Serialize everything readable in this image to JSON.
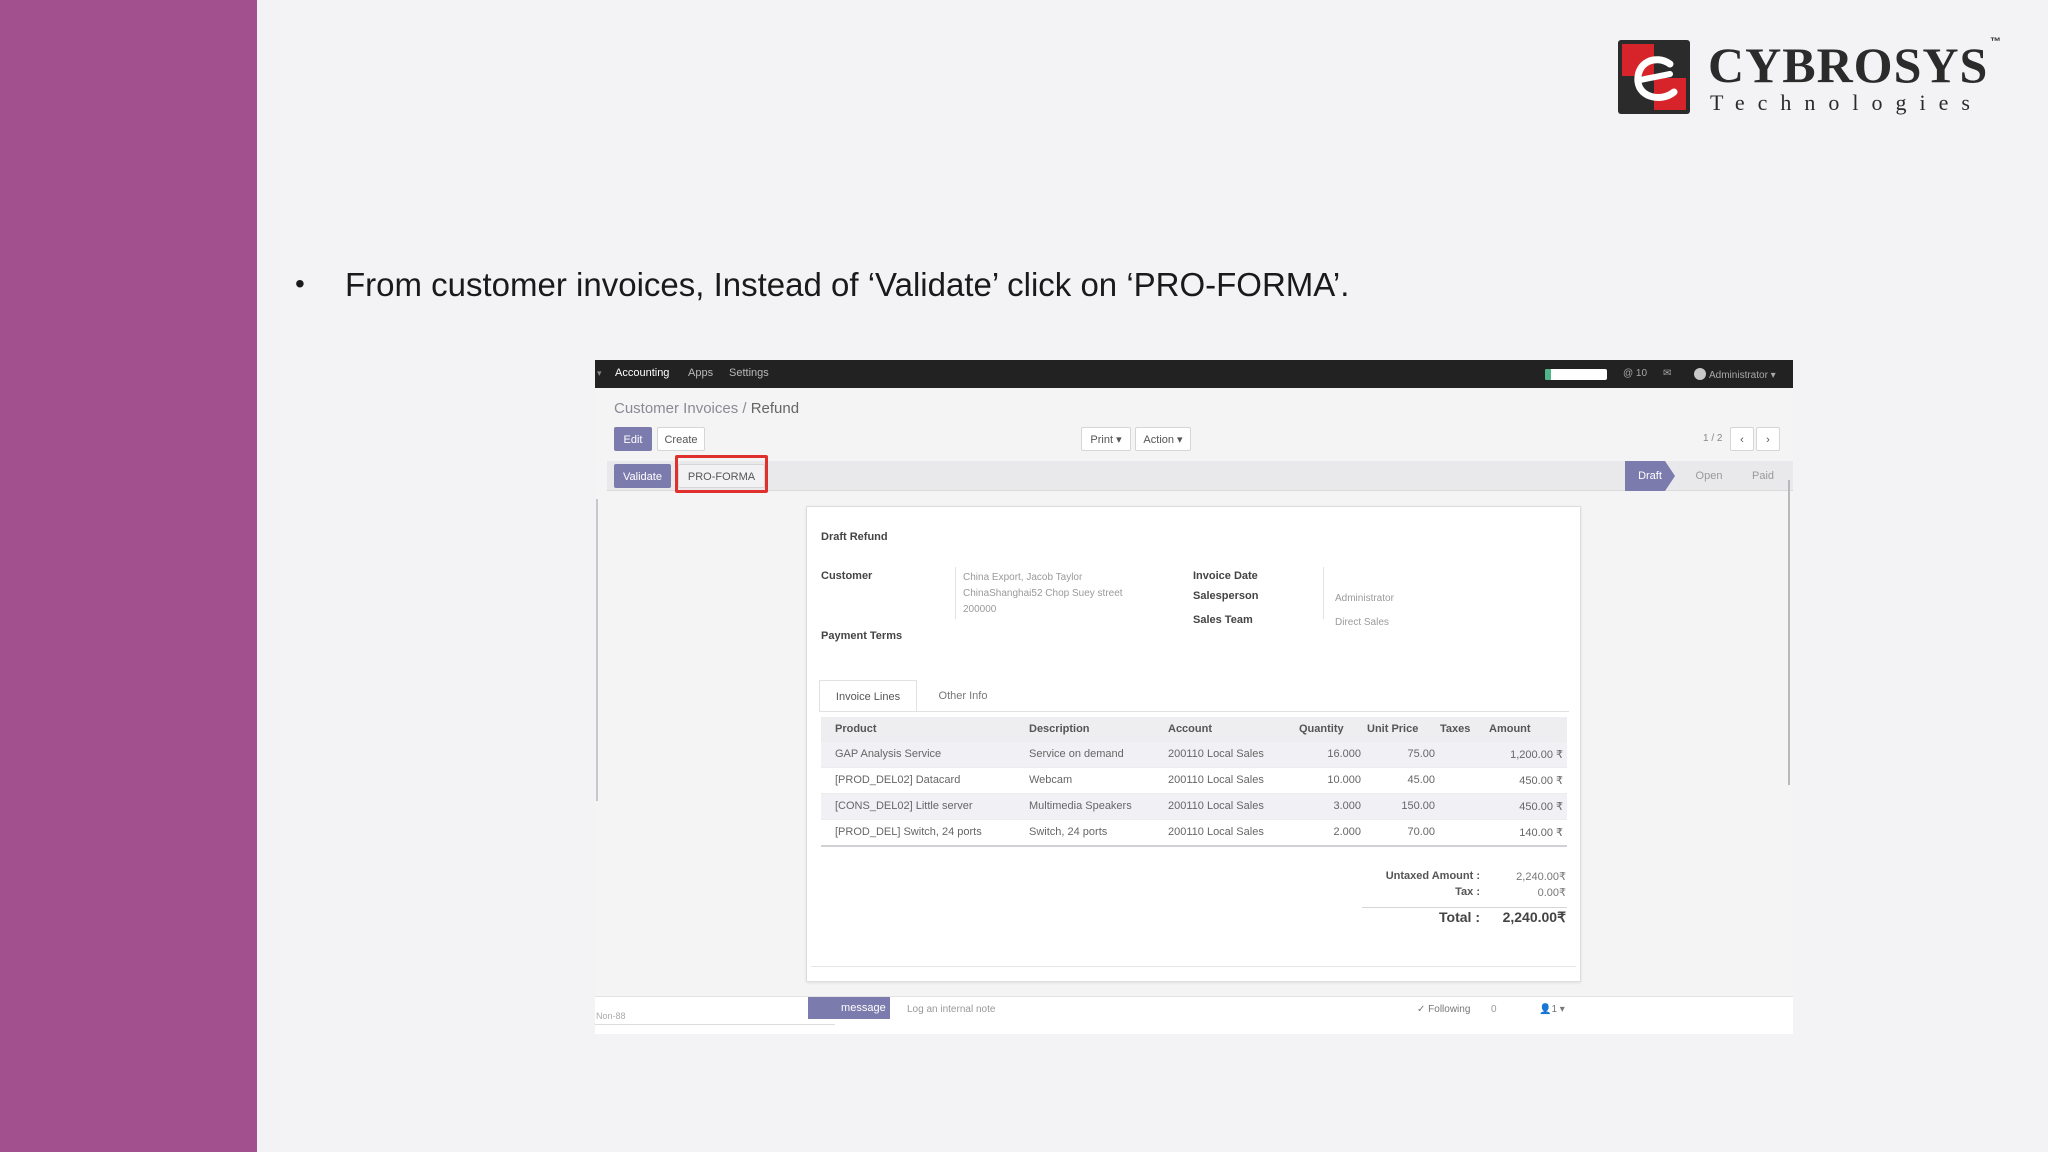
{
  "slide": {
    "accent_color": "#a3508e",
    "logo": {
      "name": "CYBROSYS",
      "tm": "™",
      "tagline": "Technologies"
    },
    "bullet": "•",
    "instruction": "From customer invoices, Instead of ‘Validate’ click on ‘PRO-FORMA’."
  },
  "app": {
    "nav": {
      "items": [
        "Accounting",
        "Apps",
        "Settings"
      ],
      "progress": 0.1,
      "counter": "@ 10",
      "user": "Administrator"
    },
    "breadcrumb": {
      "parent": "Customer Invoices /",
      "current": "Refund"
    },
    "toolbar": {
      "edit": "Edit",
      "create": "Create",
      "print": "Print ▾",
      "action": "Action ▾",
      "pager": "1 / 2",
      "prev": "‹",
      "next": "›"
    },
    "statusbar": {
      "validate": "Validate",
      "proforma": "PRO-FORMA",
      "stages": [
        "Draft",
        "Open",
        "Paid"
      ],
      "active_stage": "Draft"
    },
    "invoice": {
      "title": "Draft Refund",
      "customer_label": "Customer",
      "customer_lines": [
        "China Export, Jacob Taylor",
        "ChinaShanghai52 Chop Suey street",
        "200000"
      ],
      "payment_terms_label": "Payment Terms",
      "invoice_date_label": "Invoice Date",
      "salesperson_label": "Salesperson",
      "salesperson": "Administrator",
      "sales_team_label": "Sales Team",
      "sales_team": "Direct Sales",
      "tabs": [
        "Invoice Lines",
        "Other Info"
      ],
      "columns": [
        "Product",
        "Description",
        "Account",
        "Quantity",
        "Unit Price",
        "Taxes",
        "Amount"
      ],
      "lines": [
        {
          "product": "GAP Analysis Service",
          "description": "Service on demand",
          "account": "200110 Local Sales",
          "quantity": "16.000",
          "unit_price": "75.00",
          "taxes": "",
          "amount": "1,200.00 ₹"
        },
        {
          "product": "[PROD_DEL02] Datacard",
          "description": "Webcam",
          "account": "200110 Local Sales",
          "quantity": "10.000",
          "unit_price": "45.00",
          "taxes": "",
          "amount": "450.00 ₹"
        },
        {
          "product": "[CONS_DEL02] Little server",
          "description": "Multimedia Speakers",
          "account": "200110 Local Sales",
          "quantity": "3.000",
          "unit_price": "150.00",
          "taxes": "",
          "amount": "450.00 ₹"
        },
        {
          "product": "[PROD_DEL] Switch, 24 ports",
          "description": "Switch, 24 ports",
          "account": "200110 Local Sales",
          "quantity": "2.000",
          "unit_price": "70.00",
          "taxes": "",
          "amount": "140.00 ₹"
        }
      ],
      "untaxed_label": "Untaxed Amount :",
      "untaxed_value": "2,240.00₹",
      "tax_label": "Tax :",
      "tax_value": "0.00₹",
      "total_label": "Total :",
      "total_value": "2,240.00₹"
    },
    "chatter": {
      "input_text": "Non-88",
      "send_message": "message",
      "log_note": "Log an internal note",
      "following": "✓ Following",
      "followers_count": "0",
      "attach": "1"
    }
  }
}
